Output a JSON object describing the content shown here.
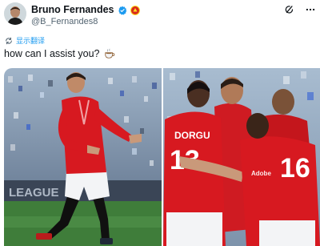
{
  "author": {
    "display_name": "Bruno Fernandes",
    "handle": "@B_Fernandes8"
  },
  "translate": {
    "label": "显示翻译"
  },
  "tweet": {
    "text": "how can I assist you?"
  },
  "media": {
    "left_photo": {
      "ad_board_text": "LEAGUE"
    },
    "right_photo": {
      "shirt_name": "DORGU",
      "shirt_number_left": "13",
      "shirt_number_right": "16",
      "sponsor": "Adobe"
    }
  },
  "colors": {
    "verified_blue": "#1d9bf0",
    "kit_red": "#d71920",
    "link_blue": "#1d9bf0"
  },
  "icons": {
    "verified": "verified-badge-icon",
    "club": "club-crest-icon",
    "grok": "grok-icon",
    "more": "more-dots-icon",
    "translate": "translate-icon",
    "coffee": "coffee-emoji-icon"
  }
}
